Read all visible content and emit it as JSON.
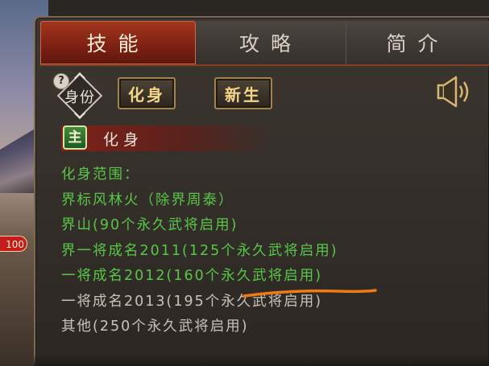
{
  "background": {
    "badge_text": "100"
  },
  "tabs": [
    {
      "label": "技能",
      "active": true
    },
    {
      "label": "攻略",
      "active": false
    },
    {
      "label": "简介",
      "active": false
    }
  ],
  "identity": {
    "help_glyph": "?",
    "label": "身份"
  },
  "buttons": {
    "avatar": "化身",
    "new_life": "新生"
  },
  "sound_icon": "speaker-icon",
  "skill": {
    "badge": "主",
    "name": "化身"
  },
  "description": {
    "lines": [
      {
        "text": "化身范围：",
        "color": "#57c846"
      },
      {
        "text": "界标风林火（除界周泰）",
        "color": "#57c846"
      },
      {
        "text": "界山(90个永久武将启用)",
        "color": "#57c846"
      },
      {
        "text": "界一将成名2011(125个永久武将启用)",
        "color": "#57c846"
      },
      {
        "text": "一将成名2012(160个永久武将启用)",
        "color": "#57c846"
      },
      {
        "text": "一将成名2013(195个永久武将启用)",
        "color": "#c9c2b7"
      },
      {
        "text": "其他(250个永久武将启用)",
        "color": "#c9c2b7"
      }
    ]
  },
  "colors": {
    "accent_red": "#7c2012",
    "gold": "#f3d68a",
    "green_text": "#57c846",
    "gray_text": "#c9c2b7",
    "highlight_stroke": "#f07a14"
  }
}
